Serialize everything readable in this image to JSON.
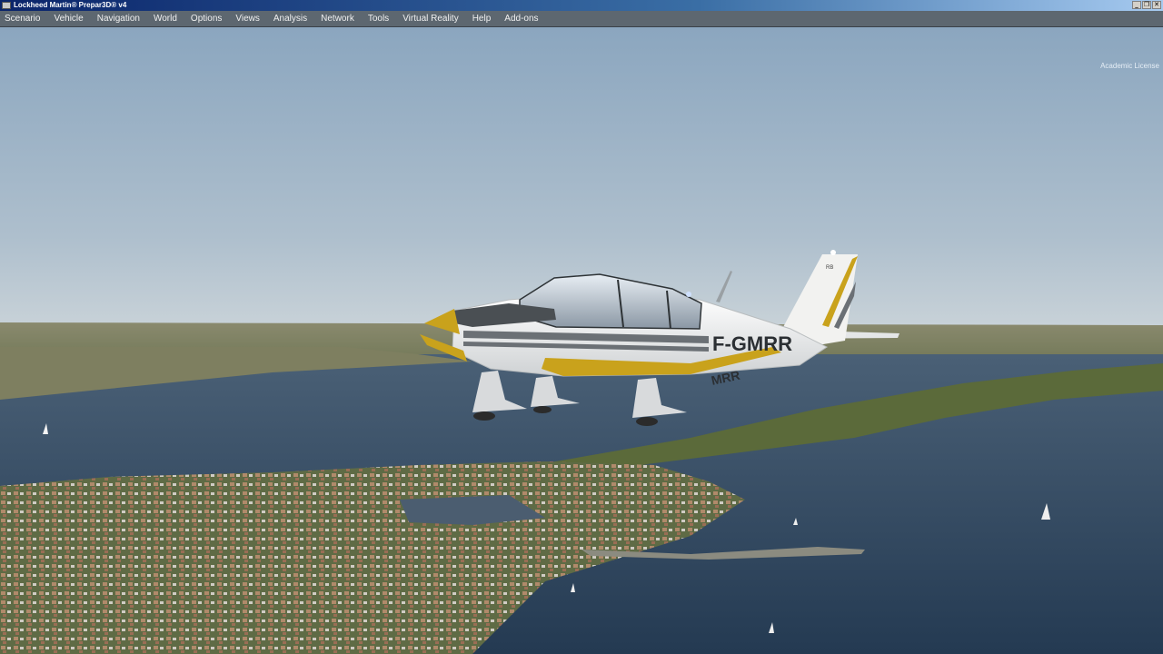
{
  "window": {
    "title": "Lockheed Martin® Prepar3D® v4",
    "controls": {
      "minimize": "_",
      "restore": "❐",
      "close": "✕"
    }
  },
  "menu": {
    "items": [
      {
        "label": "Scenario"
      },
      {
        "label": "Vehicle"
      },
      {
        "label": "Navigation"
      },
      {
        "label": "World"
      },
      {
        "label": "Options"
      },
      {
        "label": "Views"
      },
      {
        "label": "Analysis"
      },
      {
        "label": "Network"
      },
      {
        "label": "Tools"
      },
      {
        "label": "Virtual Reality"
      },
      {
        "label": "Help"
      },
      {
        "label": "Add-ons"
      }
    ]
  },
  "viewport": {
    "license_text": "Academic License",
    "aircraft": {
      "registration": "F-GMRR",
      "fuselage_code": "MRR",
      "tail_code": "RB",
      "livery_colors": {
        "base": "#f2f2f0",
        "stripe_gold": "#c9a21c",
        "stripe_grey": "#6b7075"
      }
    },
    "scene_colors": {
      "sky_top": "#8ea8c0",
      "sky_horizon": "#c6d2da",
      "sea": "#31475e",
      "land": "#5a6a3c"
    }
  }
}
